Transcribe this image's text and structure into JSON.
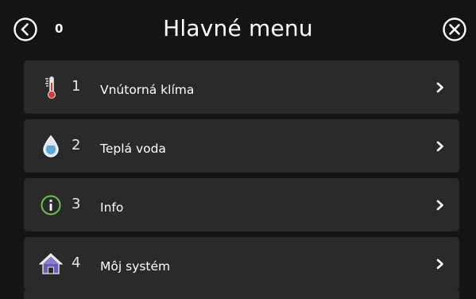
{
  "header": {
    "title": "Hlavné menu",
    "counter": "0",
    "back_icon": "back-circle-icon",
    "close_icon": "close-circle-icon"
  },
  "menu": {
    "items": [
      {
        "number": "1",
        "label": "Vnútorná klíma",
        "icon": "thermometer-icon"
      },
      {
        "number": "2",
        "label": "Teplá voda",
        "icon": "water-drop-icon"
      },
      {
        "number": "3",
        "label": "Info",
        "icon": "info-icon"
      },
      {
        "number": "4",
        "label": "Môj systém",
        "icon": "house-icon"
      }
    ]
  },
  "colors": {
    "background": "#141414",
    "item_background": "#2a2a2a",
    "info_accent": "#6cc04a",
    "thermometer_red": "#d9393b",
    "water_blue": "#5aa9d6",
    "house_purple": "#6b5ab0"
  }
}
